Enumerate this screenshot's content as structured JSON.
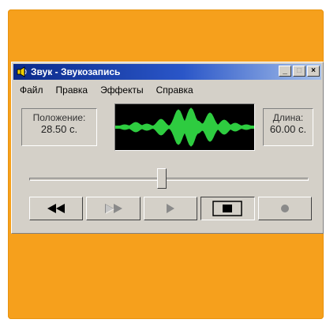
{
  "window": {
    "title": "Звук - Звукозапись",
    "title_buttons": {
      "minimize": "_",
      "maximize": "□",
      "close": "×"
    }
  },
  "menu": {
    "items": [
      "Файл",
      "Правка",
      "Эффекты",
      "Справка"
    ]
  },
  "position": {
    "label": "Положение:",
    "value": "28.50 с."
  },
  "length": {
    "label": "Длина:",
    "value": "60.00 с."
  },
  "playback": {
    "position_fraction": 0.475
  },
  "controls": [
    {
      "name": "rewind",
      "icon": "rewind-icon",
      "enabled": true
    },
    {
      "name": "fast-forward",
      "icon": "fast-forward-icon",
      "enabled": false
    },
    {
      "name": "play",
      "icon": "play-icon",
      "enabled": false
    },
    {
      "name": "stop",
      "icon": "stop-icon",
      "enabled": true
    },
    {
      "name": "record",
      "icon": "record-icon",
      "enabled": false
    }
  ],
  "colors": {
    "background": "#f6a01c",
    "waveform": "#2ecc40",
    "waveform_bg": "#000000",
    "titlebar": "#0b2a8a"
  }
}
